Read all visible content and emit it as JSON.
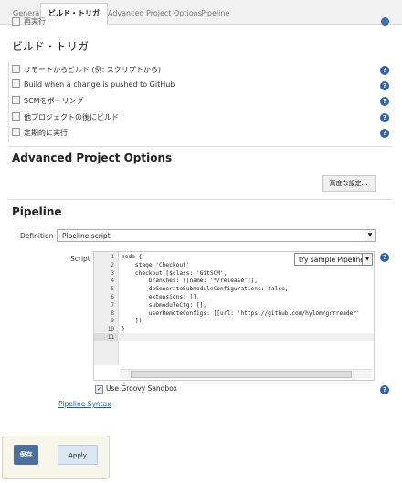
{
  "tabs": [
    {
      "label": "General"
    },
    {
      "label": "ビルド・トリガ"
    },
    {
      "label": "Advanced Project Options"
    },
    {
      "label": "Pipeline"
    }
  ],
  "cut_row_label": "再実行",
  "build_triggers": {
    "heading": "ビルド・トリガ",
    "items": [
      {
        "label": "リモートからビルド (例: スクリプトから)",
        "checked": false
      },
      {
        "label": "Build when a change is pushed to GitHub",
        "checked": false
      },
      {
        "label": "SCMをポーリング",
        "checked": false
      },
      {
        "label": "他プロジェクトの後にビルド",
        "checked": false
      },
      {
        "label": "定期的に実行",
        "checked": false
      }
    ]
  },
  "advanced": {
    "heading": "Advanced Project Options",
    "button_label": "高度な設定..."
  },
  "pipeline": {
    "heading": "Pipeline",
    "definition_label": "Definition",
    "definition_value": "Pipeline script",
    "script_label": "Script",
    "sample_select": "try sample Pipeline...",
    "line_numbers": [
      "1",
      "2",
      "3",
      "4",
      "5",
      "6",
      "7",
      "8",
      "9",
      "10",
      "11"
    ],
    "code_lines": [
      "node {",
      "    stage 'Checkout'",
      "    checkout([$class: 'GitSCM',",
      "        branches: [[name: '*/release']],",
      "        doGenerateSubmoduleConfigurations: false,",
      "        extensions: [],",
      "        submoduleCfg: [],",
      "        userRemoteConfigs: [[url: 'https://github.com/hylom/grrreader'",
      "    ])",
      "}",
      ""
    ],
    "groovy_sandbox_label": "Use Groovy Sandbox",
    "groovy_sandbox_checked": true,
    "syntax_link": "Pipeline Syntax"
  },
  "footer": {
    "save_label": "保存",
    "apply_label": "Apply"
  },
  "colors": {
    "help_icon": "#2f63b0",
    "save_button": "#4d6f9b",
    "apply_button": "#dbe6f5",
    "link": "#2a56a8"
  }
}
